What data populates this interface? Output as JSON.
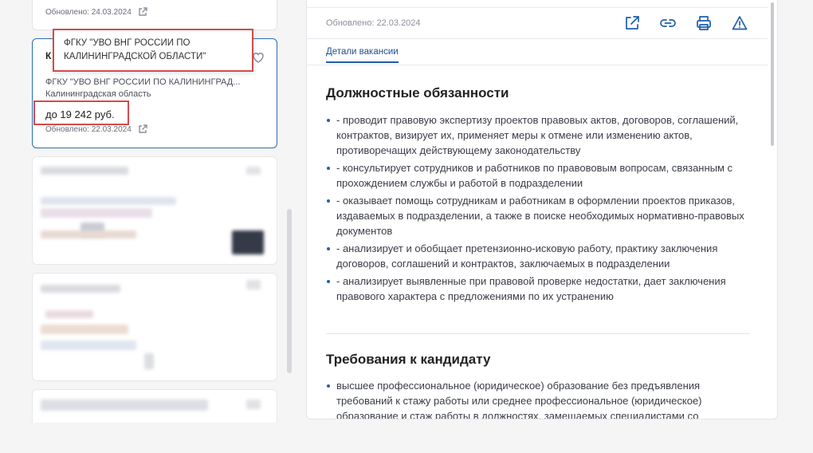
{
  "list": {
    "top_card": {
      "updated": "Обновлено: 24.03.2024"
    },
    "active_card": {
      "title_cut": "К",
      "company": "ФГКУ \"УВО ВНГ РОССИИ ПО КАЛИНИНГРАД...",
      "region": "Калининградская область",
      "salary": "до 19 242 руб.",
      "updated": "Обновлено: 22.03.2024"
    },
    "tooltip": "ФГКУ \"УВО ВНГ РОССИИ ПО КАЛИНИНГРАДСКОЙ ОБЛАСТИ\""
  },
  "detail": {
    "updated": "Обновлено: 22.03.2024",
    "tab": "Детали вакансии",
    "icons": [
      "external-link-icon",
      "link-icon",
      "printer-icon",
      "warning-icon"
    ],
    "duties": {
      "heading": "Должностные обязанности",
      "items": [
        "- проводит правовую экспертизу проектов правовых актов, договоров, соглашений, контрактов, визирует их, применяет меры к отмене или изменению актов, противоречащих действующему законодательству",
        "- консультирует сотрудников и работников по правововым вопросам, связанным с прохождением службы и работой в подразделении",
        "- оказывает помощь сотрудникам и работникам в оформлении проектов приказов, издаваемых в подразделении, а также в поиске необходимых нормативно-правовых документов",
        "- анализирует и обобщает претензионно-исковую работу, практику заключения договоров, соглашений и контрактов, заключаемых в подразделении",
        "- анализирует выявленные при правовой проверке недостатки, дает заключения правового характера с предложениями по их устранению"
      ]
    },
    "requirements": {
      "heading": "Требования к кандидату",
      "items": [
        "высшее профессиональное (юридическое) образование без предъявления требований к стажу работы или среднее профессиональное (юридическое) образование и стаж работы в должностях, замещаемых специалистами со"
      ]
    }
  },
  "colors": {
    "accent": "#1f5fa8",
    "highlight": "#d44b4b",
    "background": "#f5f5f6"
  }
}
